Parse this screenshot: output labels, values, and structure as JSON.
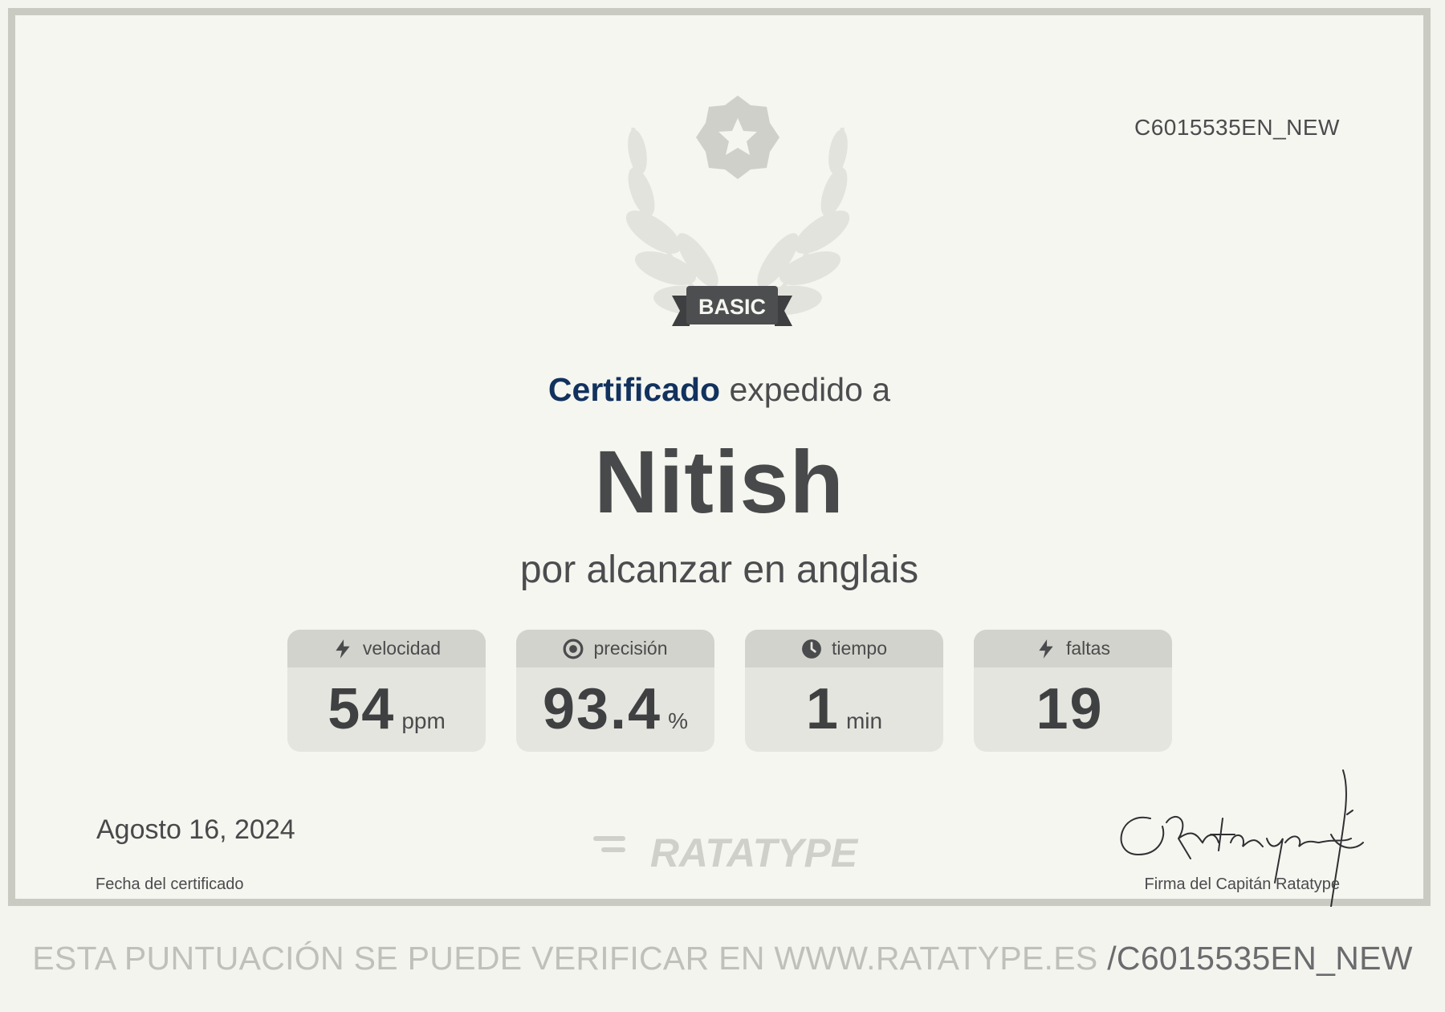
{
  "certificate": {
    "id": "C6015535EN_NEW",
    "level_badge": "BASIC",
    "issued_strong": "Certificado",
    "issued_rest": " expedido a",
    "recipient_name": "Nitish",
    "subtitle": "por alcanzar en anglais"
  },
  "stats": [
    {
      "label": "velocidad",
      "value": "54",
      "unit": "ppm",
      "icon": "lightning-icon"
    },
    {
      "label": "precisión",
      "value": "93.4",
      "unit": "%",
      "icon": "target-icon"
    },
    {
      "label": "tiempo",
      "value": "1",
      "unit": "min",
      "icon": "clock-icon"
    },
    {
      "label": "faltas",
      "value": "19",
      "unit": "",
      "icon": "lightning-icon"
    }
  ],
  "footer": {
    "date": "Agosto 16, 2024",
    "date_label": "Fecha del certificado",
    "logo_text": "RATATYPE",
    "signature_label": "Firma del Capitán Ratatype",
    "verify_prefix": "ESTA PUNTUACIÓN SE PUEDE VERIFICAR EN WWW.RATATYPE.ES ",
    "verify_code": "/C6015535EN_NEW"
  },
  "colors": {
    "background": "#f5f6f0",
    "border": "#c9cac2",
    "accent_navy": "#12325e",
    "text_dark": "#48494b",
    "stat_header": "#d2d3cc",
    "stat_body": "#e4e5de"
  }
}
